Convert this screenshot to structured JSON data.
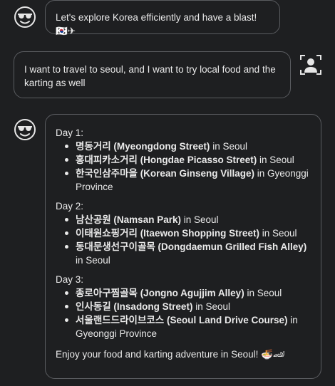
{
  "messages": [
    {
      "role": "assistant",
      "avatar_icon": "sunglasses-face-icon",
      "text": "Let's explore Korea efficiently and have a blast! 🇰🇷✈"
    },
    {
      "role": "user",
      "avatar_icon": "user-icon",
      "text": "I want to travel to seoul, and I want to try local food and the karting as well"
    },
    {
      "role": "assistant",
      "avatar_icon": "sunglasses-face-icon",
      "itinerary": [
        {
          "title": "Day 1:",
          "places": [
            {
              "name": "명동거리 (Myeongdong Street)",
              "location": " in Seoul"
            },
            {
              "name": "홍대피카소거리 (Hongdae Picasso Street)",
              "location": " in Seoul"
            },
            {
              "name": "한국인삼주마을 (Korean Ginseng Village)",
              "location": " in Gyeonggi Province"
            }
          ]
        },
        {
          "title": "Day 2:",
          "places": [
            {
              "name": "남산공원 (Namsan Park)",
              "location": " in Seoul"
            },
            {
              "name": "이태원쇼핑거리 (Itaewon Shopping Street)",
              "location": " in Seoul"
            },
            {
              "name": "동대문생선구이골목 (Dongdaemun Grilled Fish Alley)",
              "location": " in Seoul"
            }
          ]
        },
        {
          "title": "Day 3:",
          "places": [
            {
              "name": "종로아구찜골목 (Jongno Agujjim Alley)",
              "location": " in Seoul"
            },
            {
              "name": "인사동길 (Insadong Street)",
              "location": " in Seoul"
            },
            {
              "name": "서울랜드드라이브코스 (Seoul Land Drive Course)",
              "location": " in Gyeonggi Province"
            }
          ]
        }
      ],
      "closing": "Enjoy your food and karting adventure in Seoul! 🍜🏎"
    }
  ],
  "colors": {
    "background": "#1e1f21",
    "bubble_border": "#5a5c60",
    "text": "#eaeaea"
  }
}
